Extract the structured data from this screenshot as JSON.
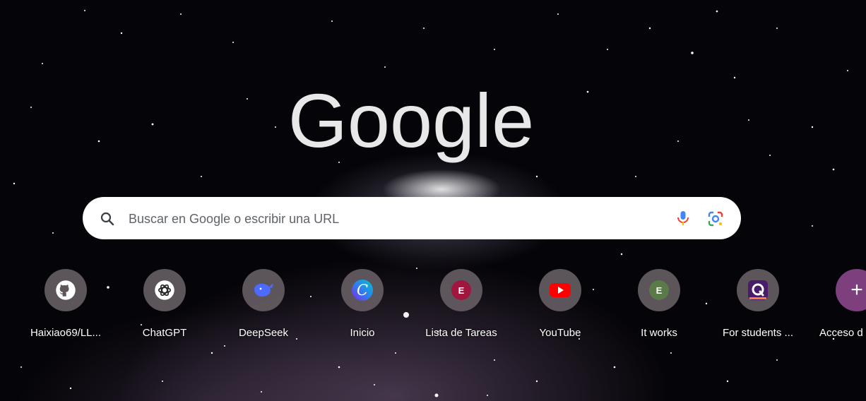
{
  "logo": {
    "text": "Google",
    "color": "#e8e8e8"
  },
  "search": {
    "placeholder": "Buscar en Google o escribir una URL",
    "icon": "search-icon",
    "voice_icon": "microphone-icon",
    "lens_icon": "google-lens-icon"
  },
  "shortcuts": [
    {
      "label": "Haixiao69/LL...",
      "icon": "github-icon"
    },
    {
      "label": "ChatGPT",
      "icon": "chatgpt-icon"
    },
    {
      "label": "DeepSeek",
      "icon": "deepseek-whale-icon",
      "color": "#4d6bfe"
    },
    {
      "label": "Inicio",
      "icon": "canva-icon",
      "color": "#7d2ae8"
    },
    {
      "label": "Lista de Tareas",
      "icon": "letter-e-icon",
      "letter": "E",
      "color": "#a0163f"
    },
    {
      "label": "YouTube",
      "icon": "youtube-icon",
      "color": "#ff0000"
    },
    {
      "label": "It works",
      "icon": "letter-e-icon",
      "letter": "E",
      "color": "#5b7a4a"
    },
    {
      "label": "For students ...",
      "icon": "quizlet-icon",
      "color": "#4a1a6b"
    }
  ],
  "add_shortcut": {
    "label": "Acceso d",
    "icon": "plus-icon",
    "color": "#7d3f7d"
  }
}
